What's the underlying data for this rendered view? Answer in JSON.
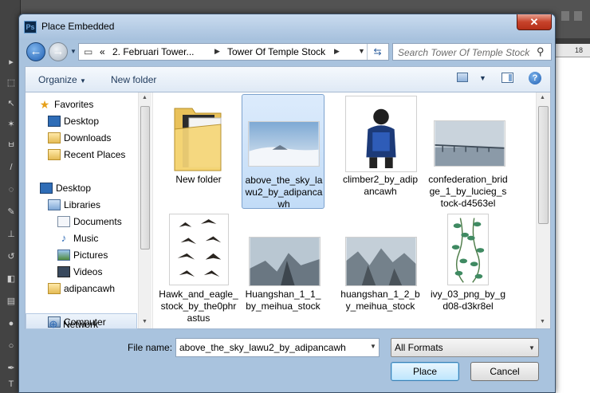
{
  "window": {
    "title": "Place Embedded",
    "app_icon_text": "Ps",
    "close_label": "✕"
  },
  "address": {
    "crumbs": [
      "2. Februari Tower...",
      "Tower Of Temple Stock"
    ],
    "overflow": "«",
    "search_placeholder": "Search Tower Of Temple Stock"
  },
  "toolbar": {
    "organize_label": "Organize",
    "new_folder_label": "New folder",
    "help_label": "?"
  },
  "nav": {
    "items": [
      {
        "label": "Favorites",
        "icon": "star-icon"
      },
      {
        "label": "Desktop",
        "icon": "desktop-icon"
      },
      {
        "label": "Downloads",
        "icon": "downloads-icon"
      },
      {
        "label": "Recent Places",
        "icon": "recent-places-icon"
      },
      {
        "label": "Desktop",
        "icon": "desktop-icon"
      },
      {
        "label": "Libraries",
        "icon": "libraries-icon"
      },
      {
        "label": "Documents",
        "icon": "documents-icon"
      },
      {
        "label": "Music",
        "icon": "music-icon"
      },
      {
        "label": "Pictures",
        "icon": "pictures-icon"
      },
      {
        "label": "Videos",
        "icon": "videos-icon"
      },
      {
        "label": "adipancawh",
        "icon": "user-folder-icon"
      },
      {
        "label": "Computer",
        "icon": "computer-icon"
      },
      {
        "label": "Network",
        "icon": "network-icon"
      }
    ],
    "selected": "Computer"
  },
  "files": [
    {
      "label": "New folder",
      "kind": "folder"
    },
    {
      "label": "above_the_sky_lawu2_by_adipancawh",
      "kind": "image",
      "selected": true
    },
    {
      "label": "climber2_by_adipancawh",
      "kind": "image"
    },
    {
      "label": "confederation_bridge_1_by_lucieg_stock-d4563el",
      "kind": "image"
    },
    {
      "label": "Hawk_and_eagle_stock_by_the0phrastus",
      "kind": "image"
    },
    {
      "label": "Huangshan_1_1_by_meihua_stock",
      "kind": "image"
    },
    {
      "label": "huangshan_1_2_by_meihua_stock",
      "kind": "image"
    },
    {
      "label": "ivy_03_png_by_gd08-d3kr8el",
      "kind": "image"
    }
  ],
  "bottom": {
    "file_name_label": "File name:",
    "file_name_value": "above_the_sky_lawu2_by_adipancawh",
    "format_value": "All Formats",
    "place_label": "Place",
    "cancel_label": "Cancel"
  },
  "background": {
    "ruler_text": "18"
  }
}
